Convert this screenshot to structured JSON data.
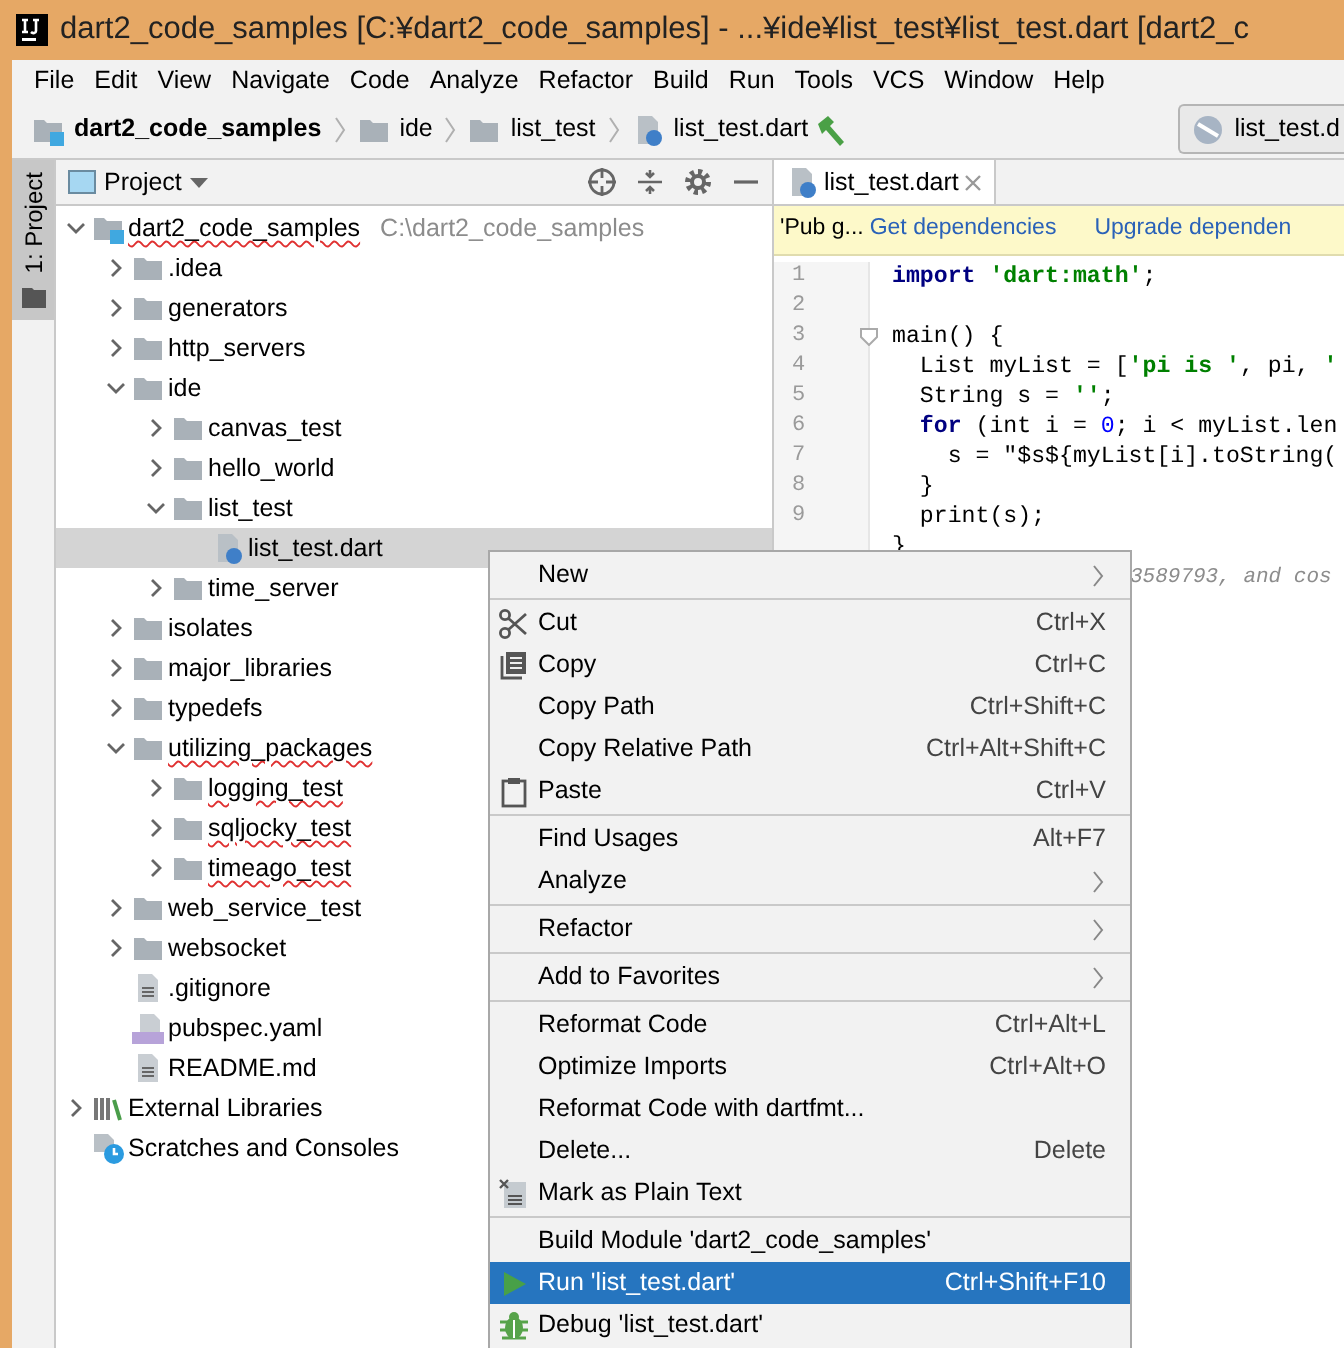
{
  "window": {
    "title": "dart2_code_samples [C:¥dart2_code_samples] - ...¥ide¥list_test¥list_test.dart [dart2_c"
  },
  "menu_bar": [
    "File",
    "Edit",
    "View",
    "Navigate",
    "Code",
    "Analyze",
    "Refactor",
    "Build",
    "Run",
    "Tools",
    "VCS",
    "Window",
    "Help"
  ],
  "breadcrumbs": [
    {
      "label": "dart2_code_samples",
      "kind": "module"
    },
    {
      "label": "ide",
      "kind": "folder"
    },
    {
      "label": "list_test",
      "kind": "folder"
    },
    {
      "label": "list_test.dart",
      "kind": "dart"
    }
  ],
  "run_config": {
    "label": "list_test.d"
  },
  "tool_strip": [
    {
      "label": "1: Project",
      "selected": true
    }
  ],
  "project_panel": {
    "title": "Project",
    "tree": [
      {
        "label": "dart2_code_samples",
        "hint": "C:\\dart2_code_samples",
        "kind": "module",
        "expanded": true,
        "selected": false,
        "misspelled": true,
        "children": [
          {
            "label": ".idea",
            "kind": "folder",
            "expanded": false,
            "selected": false,
            "misspelled": false
          },
          {
            "label": "generators",
            "kind": "folder",
            "expanded": false,
            "selected": false,
            "misspelled": false
          },
          {
            "label": "http_servers",
            "kind": "folder",
            "expanded": false,
            "selected": false,
            "misspelled": false
          },
          {
            "label": "ide",
            "kind": "folder",
            "expanded": true,
            "selected": false,
            "misspelled": false,
            "children": [
              {
                "label": "canvas_test",
                "kind": "folder",
                "expanded": false,
                "selected": false,
                "misspelled": false
              },
              {
                "label": "hello_world",
                "kind": "folder",
                "expanded": false,
                "selected": false,
                "misspelled": false
              },
              {
                "label": "list_test",
                "kind": "folder",
                "expanded": true,
                "selected": false,
                "misspelled": false,
                "children": [
                  {
                    "label": "list_test.dart",
                    "kind": "dart",
                    "selected": true,
                    "misspelled": false
                  }
                ]
              },
              {
                "label": "time_server",
                "kind": "folder",
                "expanded": false,
                "selected": false,
                "misspelled": false
              }
            ]
          },
          {
            "label": "isolates",
            "kind": "folder",
            "expanded": false,
            "selected": false,
            "misspelled": false
          },
          {
            "label": "major_libraries",
            "kind": "folder",
            "expanded": false,
            "selected": false,
            "misspelled": false
          },
          {
            "label": "typedefs",
            "kind": "folder",
            "expanded": false,
            "selected": false,
            "misspelled": false
          },
          {
            "label": "utilizing_packages",
            "kind": "folder",
            "expanded": true,
            "selected": false,
            "misspelled": true,
            "children": [
              {
                "label": "logging_test",
                "kind": "folder",
                "expanded": false,
                "selected": false,
                "misspelled": true
              },
              {
                "label": "sqljocky_test",
                "kind": "folder",
                "expanded": false,
                "selected": false,
                "misspelled": true
              },
              {
                "label": "timeago_test",
                "kind": "folder",
                "expanded": false,
                "selected": false,
                "misspelled": true
              }
            ]
          },
          {
            "label": "web_service_test",
            "kind": "folder",
            "expanded": false,
            "selected": false,
            "misspelled": false
          },
          {
            "label": "websocket",
            "kind": "folder",
            "expanded": false,
            "selected": false,
            "misspelled": false
          },
          {
            "label": ".gitignore",
            "kind": "text",
            "selected": false,
            "misspelled": false
          },
          {
            "label": "pubspec.yaml",
            "kind": "yaml",
            "selected": false,
            "misspelled": false
          },
          {
            "label": "README.md",
            "kind": "text",
            "selected": false,
            "misspelled": false
          }
        ]
      },
      {
        "label": "External Libraries",
        "kind": "libraries",
        "expanded": false,
        "selected": false,
        "misspelled": false
      },
      {
        "label": "Scratches and Consoles",
        "kind": "scratches",
        "selected": false,
        "misspelled": false
      }
    ]
  },
  "editor": {
    "tabs": [
      {
        "label": "list_test.dart",
        "selected": true
      }
    ],
    "banner": {
      "message": "'Pub g...",
      "actions": [
        "Get dependencies",
        "Upgrade dependen"
      ]
    },
    "lines": [
      {
        "number": "1",
        "tokens": [
          {
            "kind": "keyword",
            "text": "import"
          },
          {
            "kind": "string",
            "text": " 'dart:math'"
          },
          {
            "kind": "plain",
            "text": ";"
          }
        ]
      },
      {
        "number": "2"
      },
      {
        "number": "3",
        "fold": true,
        "tokens": [
          {
            "kind": "plain",
            "text": "main() {"
          }
        ]
      },
      {
        "number": "4",
        "tokens": [
          {
            "kind": "plain",
            "text": "  List myList = ["
          },
          {
            "kind": "string",
            "text": "'pi is '"
          },
          {
            "kind": "plain",
            "text": ", pi, "
          },
          {
            "kind": "string",
            "text": "'"
          }
        ]
      },
      {
        "number": "5",
        "tokens": [
          {
            "kind": "plain",
            "text": "  String s = "
          },
          {
            "kind": "string",
            "text": "''"
          },
          {
            "kind": "plain",
            "text": ";"
          }
        ]
      },
      {
        "number": "6",
        "tokens": [
          {
            "kind": "keyword",
            "text": "  for"
          },
          {
            "kind": "plain",
            "text": " (int i = "
          },
          {
            "kind": "number",
            "text": "0"
          },
          {
            "kind": "plain",
            "text": "; i < myList.len"
          }
        ]
      },
      {
        "number": "7",
        "tokens": [
          {
            "kind": "plain",
            "text": "    s = \"$s${myList[i].toString("
          }
        ]
      },
      {
        "number": "8",
        "tokens": [
          {
            "kind": "plain",
            "text": "  }"
          }
        ]
      },
      {
        "number": "9",
        "tokens": [
          {
            "kind": "plain",
            "text": "  print(s);"
          }
        ]
      },
      {
        "tokens": [
          {
            "kind": "plain",
            "text": "}"
          }
        ]
      },
      {
        "tokens": [
          {
            "kind": "hint",
            "text": "3589793, and cos"
          }
        ]
      }
    ]
  },
  "context_menu": {
    "groups": [
      [
        {
          "label": "New",
          "submenu": true,
          "selected": false
        }
      ],
      [
        {
          "label": "Cut",
          "kind": "scissors",
          "shortcut": "Ctrl+X",
          "selected": false
        },
        {
          "label": "Copy",
          "kind": "copy",
          "shortcut": "Ctrl+C",
          "selected": false
        },
        {
          "label": "Copy Path",
          "shortcut": "Ctrl+Shift+C",
          "selected": false
        },
        {
          "label": "Copy Relative Path",
          "shortcut": "Ctrl+Alt+Shift+C",
          "selected": false
        },
        {
          "label": "Paste",
          "kind": "clipboard",
          "shortcut": "Ctrl+V",
          "selected": false
        }
      ],
      [
        {
          "label": "Find Usages",
          "shortcut": "Alt+F7",
          "selected": false
        },
        {
          "label": "Analyze",
          "submenu": true,
          "selected": false
        }
      ],
      [
        {
          "label": "Refactor",
          "submenu": true,
          "selected": false
        }
      ],
      [
        {
          "label": "Add to Favorites",
          "submenu": true,
          "selected": false
        }
      ],
      [
        {
          "label": "Reformat Code",
          "shortcut": "Ctrl+Alt+L",
          "selected": false
        },
        {
          "label": "Optimize Imports",
          "shortcut": "Ctrl+Alt+O",
          "selected": false
        },
        {
          "label": "Reformat Code with dartfmt...",
          "selected": false
        },
        {
          "label": "Delete...",
          "shortcut": "Delete",
          "selected": false
        },
        {
          "label": "Mark as Plain Text",
          "kind": "plaintext",
          "selected": false
        }
      ],
      [
        {
          "label": "Build Module 'dart2_code_samples'",
          "selected": false
        },
        {
          "label": "Run 'list_test.dart'",
          "kind": "run",
          "shortcut": "Ctrl+Shift+F10",
          "selected": true
        },
        {
          "label": "Debug 'list_test.dart'",
          "kind": "bug",
          "selected": false
        }
      ]
    ]
  }
}
